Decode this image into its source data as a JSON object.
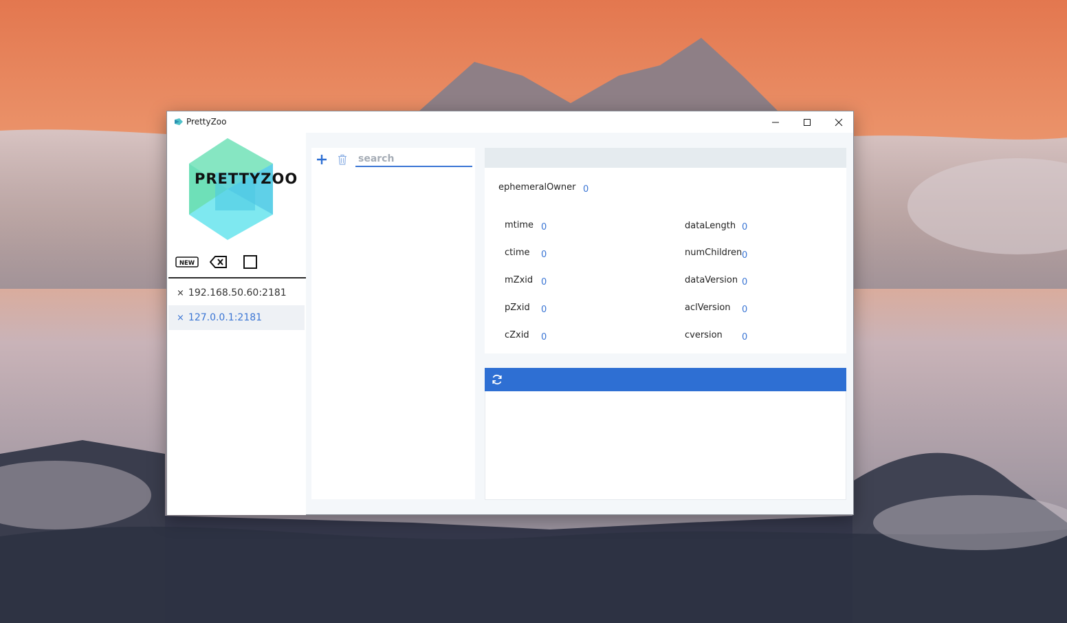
{
  "window": {
    "title": "PrettyZoo",
    "controls": [
      "minimize-icon",
      "maximize-icon",
      "close-icon"
    ]
  },
  "sidebar": {
    "logo_text": "PRETTYZOO",
    "toolbar": {
      "new_label": "NEW",
      "icons": [
        "new-server-icon",
        "delete-server-icon",
        "select-icon"
      ]
    },
    "servers": [
      {
        "label": "192.168.50.60:2181",
        "active": false
      },
      {
        "label": "127.0.0.1:2181",
        "active": true
      }
    ],
    "close_glyph": "×"
  },
  "tree": {
    "search_placeholder": "search",
    "search_value": "",
    "icons": [
      "add-icon",
      "trash-icon"
    ]
  },
  "stat": {
    "ephemeralOwner": {
      "label": "ephemeralOwner",
      "value": "0"
    },
    "left": [
      {
        "label": "mtime",
        "value": "0"
      },
      {
        "label": "ctime",
        "value": "0"
      },
      {
        "label": "mZxid",
        "value": "0"
      },
      {
        "label": "pZxid",
        "value": "0"
      },
      {
        "label": "cZxid",
        "value": "0"
      }
    ],
    "right": [
      {
        "label": "dataLength",
        "value": "0"
      },
      {
        "label": "numChildren",
        "value": "0"
      },
      {
        "label": "dataVersion",
        "value": "0"
      },
      {
        "label": "aclVersion",
        "value": "0"
      },
      {
        "label": "cversion",
        "value": "0"
      }
    ]
  },
  "data_panel": {
    "icon": "refresh-icon",
    "content": ""
  },
  "colors": {
    "accent": "#2e6fd3",
    "link": "#3a75d4",
    "panel_bg": "#f4f7fa",
    "sky_top": "#e8805a",
    "sky_bottom": "#f0a678"
  }
}
